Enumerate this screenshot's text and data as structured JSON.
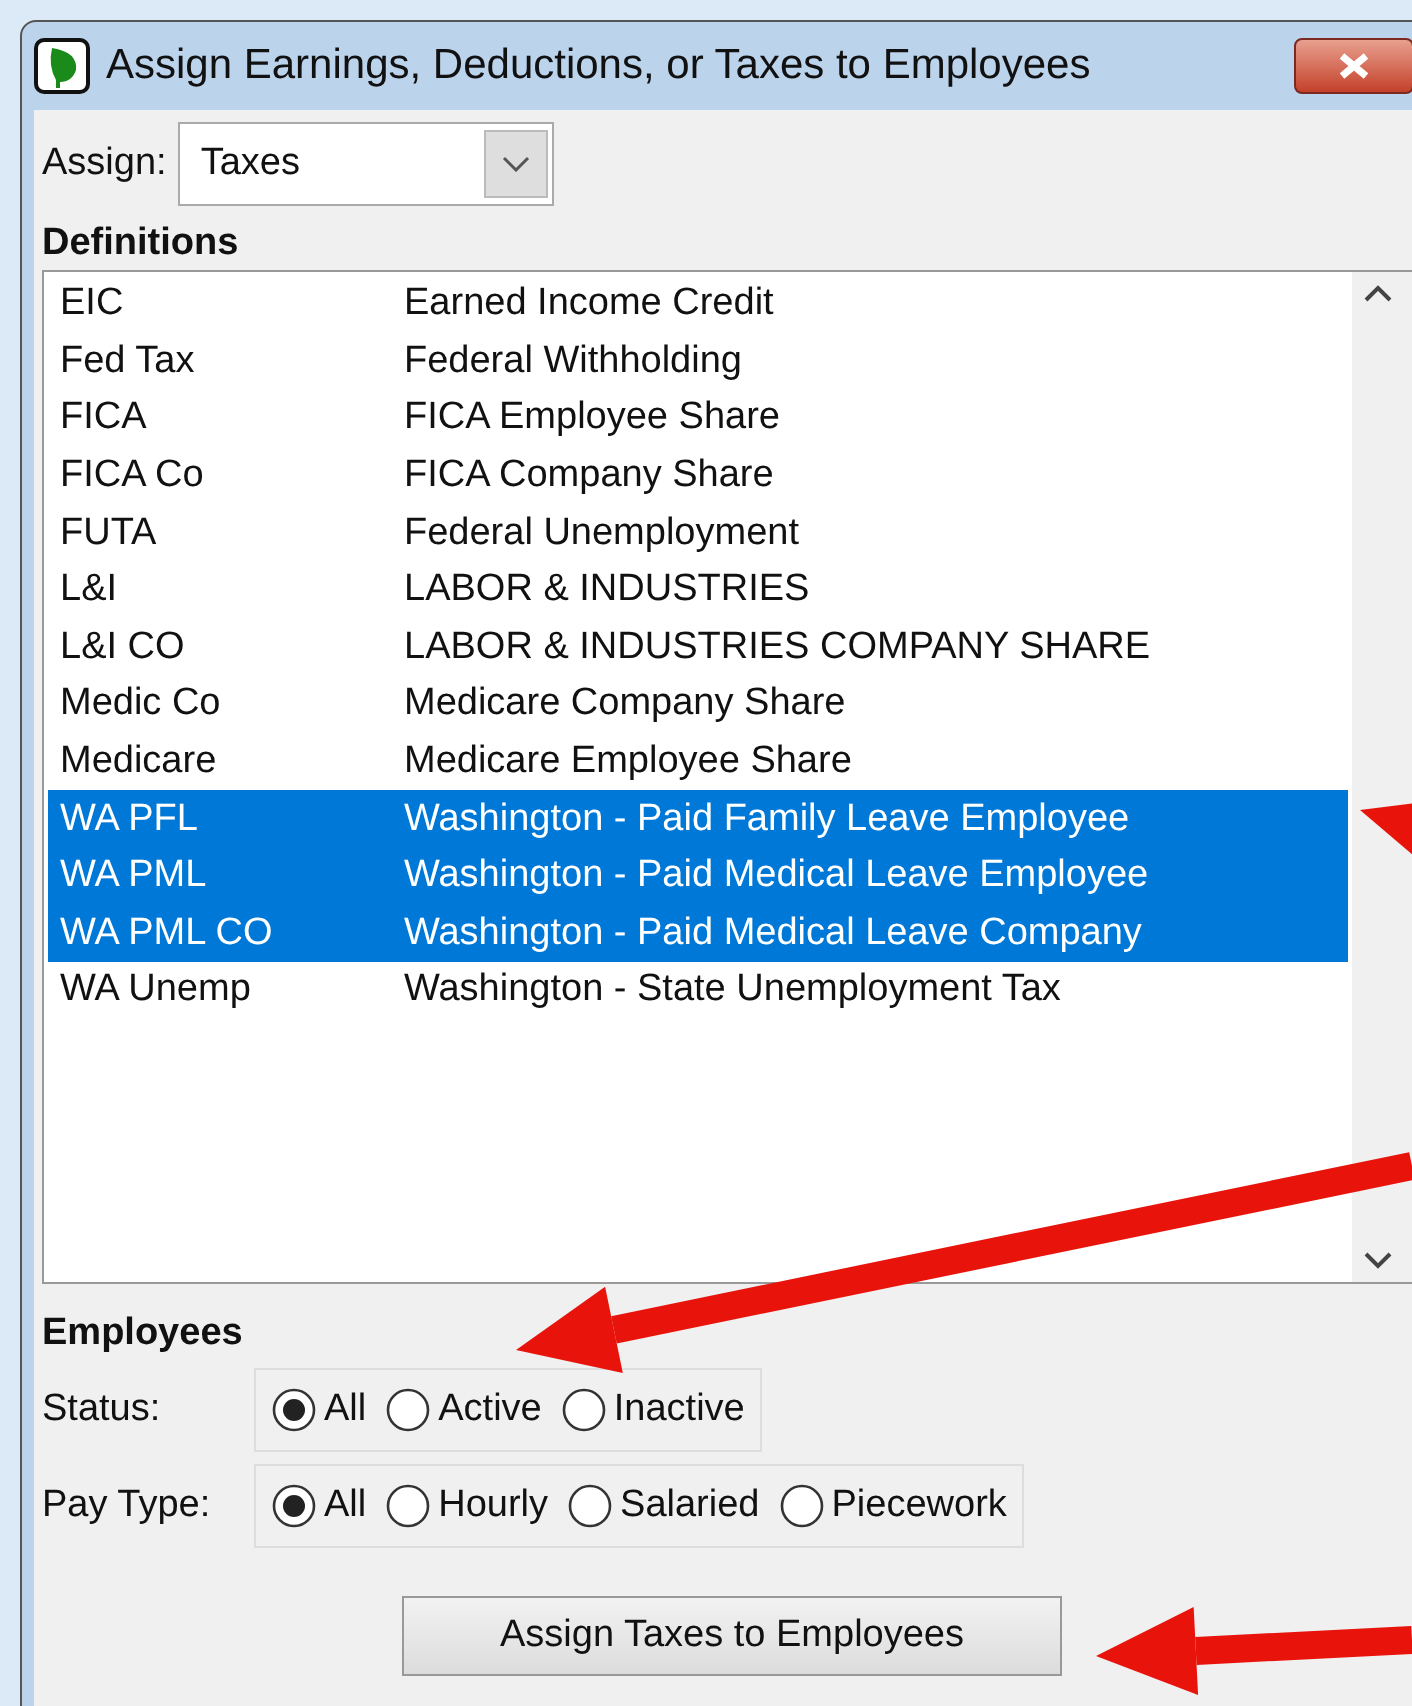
{
  "window": {
    "title": "Assign Earnings, Deductions, or Taxes to Employees"
  },
  "assign": {
    "label": "Assign:",
    "value": "Taxes"
  },
  "definitions": {
    "heading": "Definitions",
    "rows": [
      {
        "code": "EIC",
        "description": "Earned Income Credit",
        "selected": false
      },
      {
        "code": "Fed Tax",
        "description": "Federal Withholding",
        "selected": false
      },
      {
        "code": "FICA",
        "description": "FICA Employee Share",
        "selected": false
      },
      {
        "code": "FICA Co",
        "description": "FICA Company Share",
        "selected": false
      },
      {
        "code": "FUTA",
        "description": "Federal Unemployment",
        "selected": false
      },
      {
        "code": "L&I",
        "description": "LABOR & INDUSTRIES",
        "selected": false
      },
      {
        "code": "L&I CO",
        "description": "LABOR & INDUSTRIES COMPANY SHARE",
        "selected": false
      },
      {
        "code": "Medic Co",
        "description": "Medicare Company Share",
        "selected": false
      },
      {
        "code": "Medicare",
        "description": "Medicare Employee Share",
        "selected": false
      },
      {
        "code": "WA PFL",
        "description": "Washington - Paid Family Leave Employee",
        "selected": true
      },
      {
        "code": "WA PML",
        "description": "Washington - Paid Medical Leave Employee",
        "selected": true
      },
      {
        "code": "WA PML CO",
        "description": "Washington - Paid Medical Leave Company",
        "selected": true
      },
      {
        "code": "WA Unemp",
        "description": "Washington - State Unemployment Tax",
        "selected": false
      }
    ]
  },
  "employees": {
    "heading": "Employees",
    "filters": [
      {
        "label": "Status:",
        "options": [
          {
            "label": "All",
            "selected": true
          },
          {
            "label": "Active",
            "selected": false
          },
          {
            "label": "Inactive",
            "selected": false
          }
        ]
      },
      {
        "label": "Pay Type:",
        "options": [
          {
            "label": "All",
            "selected": true
          },
          {
            "label": "Hourly",
            "selected": false
          },
          {
            "label": "Salaried",
            "selected": false
          },
          {
            "label": "Piecework",
            "selected": false
          }
        ]
      }
    ]
  },
  "assign_button": {
    "label": "Assign Taxes to Employees"
  }
}
